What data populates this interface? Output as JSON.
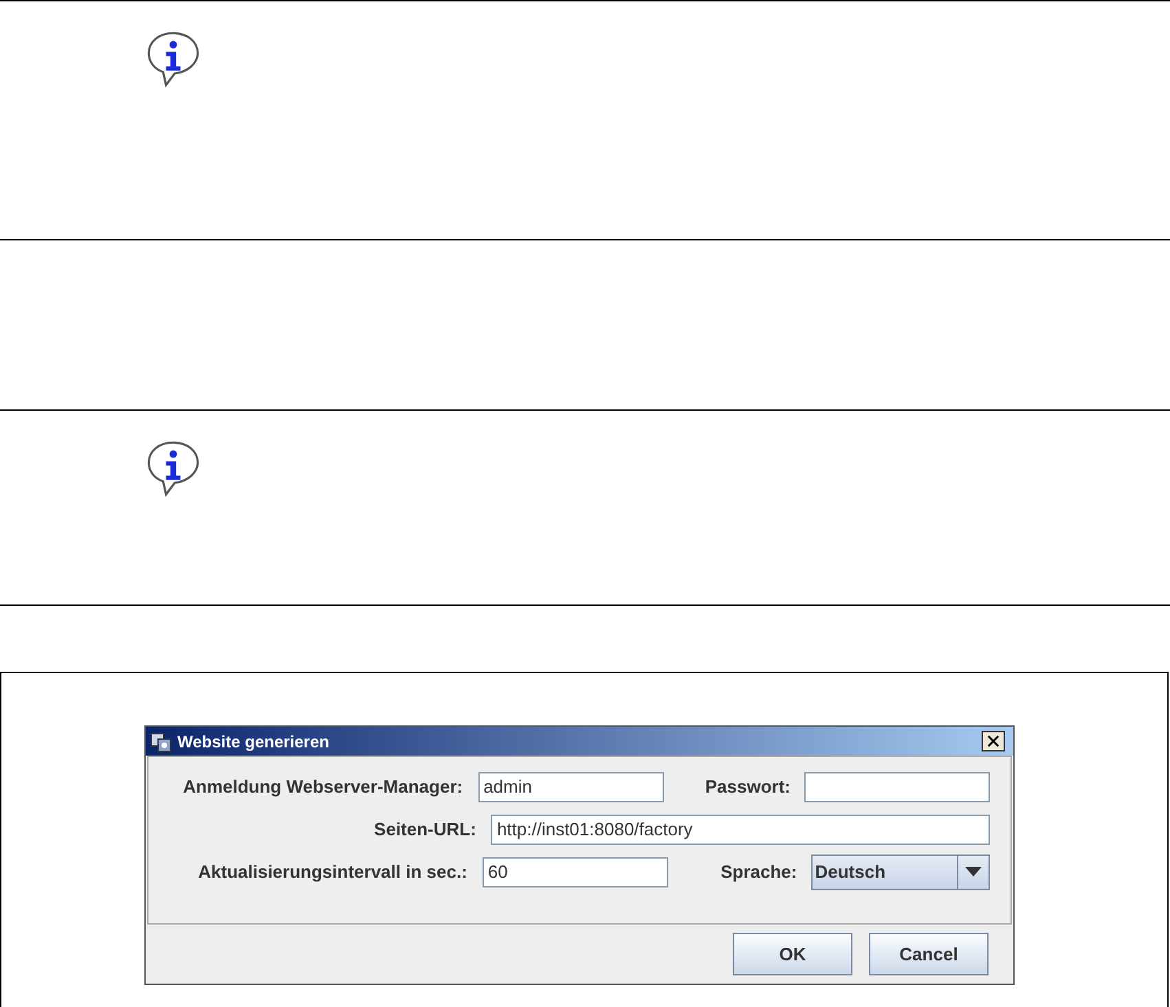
{
  "sections": [
    {
      "kind": "note"
    },
    {
      "kind": "empty"
    },
    {
      "kind": "note"
    }
  ],
  "dialog": {
    "title": "Website generieren",
    "rows": [
      {
        "fields": [
          {
            "kind": "text",
            "label": "Anmeldung Webserver-Manager:",
            "value": "admin"
          },
          {
            "kind": "text",
            "label": "Passwort:"
          }
        ]
      },
      {
        "fields": [
          {
            "kind": "text",
            "label": "Seiten-URL:",
            "value": "http://inst01:8080/factory",
            "wide": true
          }
        ]
      },
      {
        "fields": [
          {
            "kind": "text",
            "label": "Aktualisierungsintervall in sec.:",
            "value": "60"
          },
          {
            "kind": "select",
            "label": "Sprache:",
            "value": "Deutsch"
          }
        ]
      }
    ],
    "buttons": [
      "OK",
      "Cancel"
    ]
  }
}
